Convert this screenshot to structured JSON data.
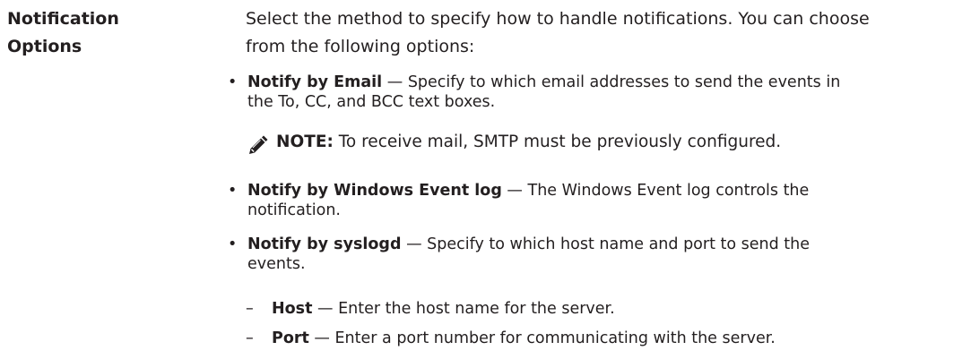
{
  "term": {
    "line1": "Notification",
    "line2": "Options"
  },
  "description": {
    "line1": "Select the method to specify how to handle notifications. You can choose",
    "line2": "from the following options:"
  },
  "options": [
    {
      "bullet": "•",
      "label": "Notify by Email",
      "sep": " — ",
      "line1": "Specify to which email addresses to send the events in",
      "line2": "the To, CC, and BCC text boxes."
    },
    {
      "bullet": "•",
      "label": "Notify by Windows Event log",
      "sep": " — ",
      "line1": "The Windows Event log controls the",
      "line2": "notification."
    },
    {
      "bullet": "•",
      "label": "Notify by syslogd",
      "sep": " — ",
      "line1": "Specify to which host name and port to send the",
      "line2": "events."
    }
  ],
  "note": {
    "icon": "pencil-note-icon",
    "label": "NOTE:",
    "text": " To receive mail, SMTP must be previously configured."
  },
  "sub_options": [
    {
      "dash": "–",
      "label": "Host",
      "sep": " — ",
      "text": "Enter the host name for the server."
    },
    {
      "dash": "–",
      "label": "Port",
      "sep": " — ",
      "text": "Enter a port number for communicating with the server."
    }
  ]
}
